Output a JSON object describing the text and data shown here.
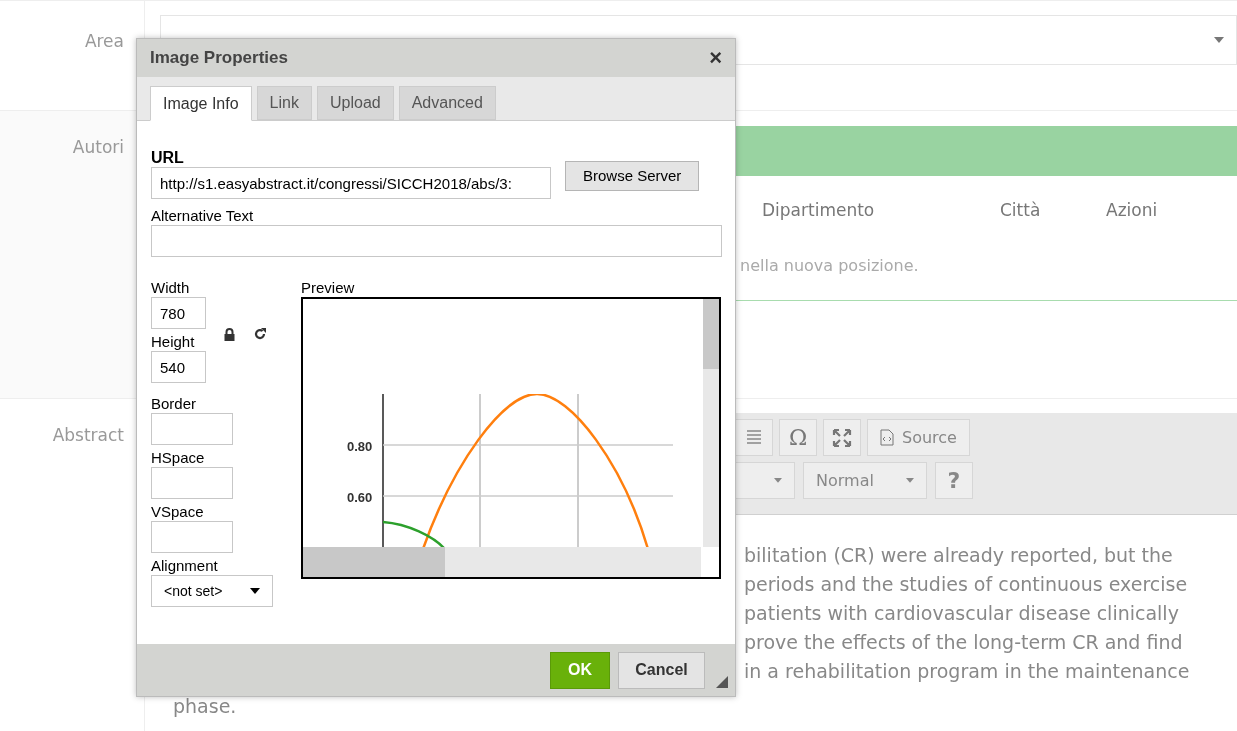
{
  "form": {
    "rows": [
      {
        "label": "Area"
      },
      {
        "label": "Autori"
      },
      {
        "label": "Abstract"
      }
    ],
    "authors_table": {
      "columns": [
        "Dipartimento",
        "Città",
        "Azioni"
      ],
      "hint": "nella nuova posizione."
    },
    "editor": {
      "toolbar": [
        {
          "kind": "list"
        },
        {
          "kind": "glyph",
          "label": "Ω"
        },
        {
          "kind": "maximize"
        },
        {
          "kind": "source",
          "label": "Source"
        }
      ],
      "selects": [
        {
          "kind": "narrow"
        },
        {
          "kind": "wide",
          "value": "Normal"
        }
      ],
      "help": "?",
      "lines": [
        "bilitation (CR) were already reported, but the",
        "periods and the studies of continuous exercise",
        "patients with cardiovascular disease clinically",
        "prove the effects of the long-term CR and find",
        "in a rehabilitation program in the maintenance"
      ],
      "last_line": "phase."
    }
  },
  "dialog": {
    "title": "Image Properties",
    "close": "×",
    "tabs": [
      {
        "label": "Image Info",
        "selected": true
      },
      {
        "label": "Link",
        "selected": false
      },
      {
        "label": "Upload",
        "selected": false
      },
      {
        "label": "Advanced",
        "selected": false
      }
    ],
    "url": {
      "label": "URL",
      "value": "http://s1.easyabstract.it/congressi/SICCH2018/abs/3:"
    },
    "browse": "Browse Server",
    "alt": {
      "label": "Alternative Text"
    },
    "width": {
      "label": "Width",
      "value": "780"
    },
    "height": {
      "label": "Height",
      "value": "540"
    },
    "border": {
      "label": "Border"
    },
    "hspace": {
      "label": "HSpace"
    },
    "vspace": {
      "label": "VSpace"
    },
    "alignment": {
      "label": "Alignment",
      "value": "<not set>"
    },
    "preview": {
      "label": "Preview",
      "tick_labels": [
        "0.80",
        "0.60"
      ]
    },
    "ok": "OK",
    "cancel": "Cancel"
  }
}
